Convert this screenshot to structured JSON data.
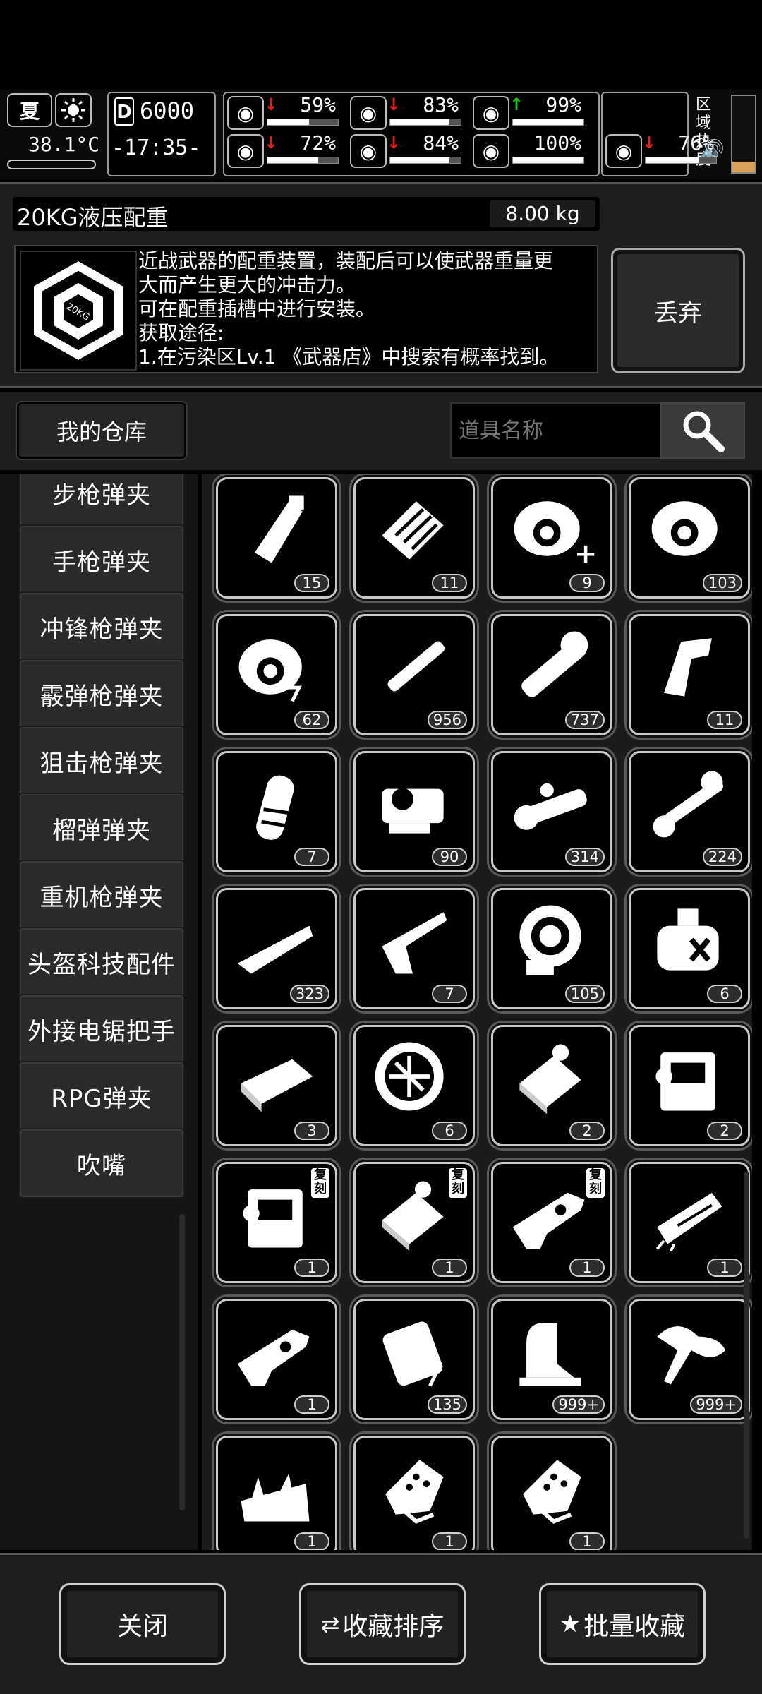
{
  "status": {
    "season": "夏",
    "temperature": "38.1°C",
    "day": "6000",
    "time": "-17:35-",
    "stats": [
      {
        "icon": "medkit-icon",
        "trend": "down",
        "value": "59%",
        "fill": 0.59
      },
      {
        "icon": "stomach-icon",
        "trend": "down",
        "value": "83%",
        "fill": 0.83
      },
      {
        "icon": "pill-icon",
        "trend": "up",
        "value": "99%",
        "fill": 0.99
      },
      {
        "icon": "brain-icon",
        "trend": "down",
        "value": "72%",
        "fill": 0.72
      },
      {
        "icon": "water-drop-icon",
        "trend": "down",
        "value": "84%",
        "fill": 0.84
      },
      {
        "icon": "heart-icon",
        "trend": "none",
        "value": "100%",
        "fill": 1.0
      },
      {
        "icon": "boot-icon",
        "trend": "down",
        "value": "76%",
        "fill": 0.76
      }
    ],
    "zone_label_1": "区域",
    "zone_label_2": "热度",
    "trend_down_color": "#e02020",
    "trend_up_color": "#20c020"
  },
  "item": {
    "name": "20KG液压配重",
    "weight": "8.00 kg",
    "icon_text": "20KG",
    "description": [
      "近战武器的配重装置，装配后可以使武器重量更",
      "大而产生更大的冲击力。",
      "可在配重插槽中进行安装。",
      "获取途径:",
      "1.在污染区Lv.1 《武器店》中搜索有概率找到。"
    ],
    "discard_label": "丢弃"
  },
  "warehouse": {
    "title": "我的仓库",
    "search_placeholder": "道具名称"
  },
  "categories": [
    "步枪弹夹",
    "手枪弹夹",
    "冲锋枪弹夹",
    "霰弹枪弹夹",
    "狙击枪弹夹",
    "榴弹弹夹",
    "重机枪弹夹",
    "头盔科技配件",
    "外接电锯把手",
    "RPG弹夹",
    "吹嘴"
  ],
  "items": [
    {
      "icon": "rifle-magazine-icon",
      "count": "15"
    },
    {
      "icon": "ammo-box-icon",
      "count": "11"
    },
    {
      "icon": "target-helmet-plus-icon",
      "count": "9"
    },
    {
      "icon": "target-helmet-icon",
      "count": "103"
    },
    {
      "icon": "target-helmet-bolt-icon",
      "count": "62"
    },
    {
      "icon": "suppressor-icon",
      "count": "956"
    },
    {
      "icon": "flashlight-icon",
      "count": "737"
    },
    {
      "icon": "grip-icon",
      "count": "11"
    },
    {
      "icon": "vertical-grip-icon",
      "count": "7"
    },
    {
      "icon": "red-dot-sight-icon",
      "count": "90"
    },
    {
      "icon": "scope-icon",
      "count": "314"
    },
    {
      "icon": "sniper-scope-icon",
      "count": "224"
    },
    {
      "icon": "wood-stock-icon",
      "count": "323"
    },
    {
      "icon": "rifle-stock-icon",
      "count": "7"
    },
    {
      "icon": "drum-magazine-icon",
      "count": "105"
    },
    {
      "icon": "canister-icon",
      "count": "6"
    },
    {
      "icon": "battery-pack-icon",
      "count": "3"
    },
    {
      "icon": "fan-module-icon",
      "count": "6"
    },
    {
      "icon": "weight-block-icon",
      "count": "2"
    },
    {
      "icon": "armor-module-icon",
      "count": "2"
    },
    {
      "icon": "armor-module-icon",
      "count": "1",
      "fav": "复刻"
    },
    {
      "icon": "weight-block-icon",
      "count": "1",
      "fav": "复刻"
    },
    {
      "icon": "gun-part-icon",
      "count": "1",
      "fav": "复刻"
    },
    {
      "icon": "chainsaw-handle-icon",
      "count": "1"
    },
    {
      "icon": "gun-part-icon",
      "count": "1"
    },
    {
      "icon": "power-cell-icon",
      "count": "135"
    },
    {
      "icon": "rail-mount-icon",
      "count": "999+"
    },
    {
      "icon": "mouthpiece-icon",
      "count": "999+"
    },
    {
      "icon": "spiked-wrap-icon",
      "count": "1"
    },
    {
      "icon": "knuckle-guard-icon",
      "count": "1"
    },
    {
      "icon": "knuckle-guard-icon",
      "count": "1"
    }
  ],
  "bottom": {
    "close_label": "关闭",
    "sort_label": "收藏排序",
    "batch_label": "批量收藏"
  }
}
